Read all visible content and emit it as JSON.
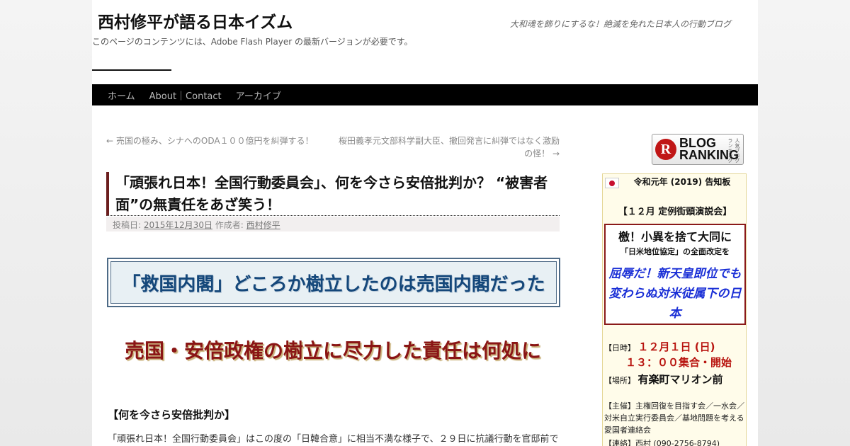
{
  "header": {
    "site_title": "西村修平が語る日本イズム",
    "tagline": "大和魂を飾りにするな！絶滅を免れた日本人の行動ブログ",
    "flash_note": "このページのコンテンツには、Adobe Flash Player の最新バージョンが必要です。"
  },
  "nav": {
    "items": [
      "ホーム",
      "About｜Contact",
      "アーカイブ"
    ]
  },
  "post_nav": {
    "prev": "← 売国の極み、シナへのODA１００億円を糾弾する！",
    "next": "桜田義孝元文部科学副大臣、撤回発言に糾弾ではなく激励の怪！ →"
  },
  "post": {
    "title": "「頑張れ日本！全国行動委員会」、何を今さら安倍批判か？ “被害者面”の無責任をあざ笑う！",
    "meta_posted_label": "投稿日:",
    "meta_date": "2015年12月30日",
    "meta_author_label": "作成者:",
    "meta_author": "西村修平",
    "banner1": "「救国内閣」どころか樹立したのは売国内閣だった",
    "banner2": "売国・安倍政権の樹立に尽力した責任は何処に",
    "section_heading": "【何を今さら安倍批判か】",
    "body_first_line": "「頑張れ日本！全国行動委員会」はこの度の「日韓合意」に相当不満な様子で、２９日に抗議行動を官邸前で"
  },
  "sidebar": {
    "ranking_badge": {
      "logo_letter": "R",
      "text_line1": "BLOG",
      "text_line2": "RANKING",
      "vertical_text": "人気ブログランキング"
    },
    "notice": {
      "heading": "令和元年 (2019) 告知板",
      "event_title": "【１２月 定例街頭演説会】",
      "slogan1": "檄！小異を捨て大同に",
      "slogan2": "「日米地位協定」の全面改定を",
      "slogan3": "屈辱だ！新天皇即位でも変わらぬ対米従属下の日本",
      "date_label": "【日時】",
      "date_value": "１２月１日 (日)",
      "time_value": "１３：００集合・開始",
      "place_label": "【場所】",
      "place_value": "有楽町マリオン前",
      "sponsor": "【主催】主権回復を目指す会／一水会／対米自立実行委員会／基地問題を考える愛国者連絡会",
      "contact": "【連絡】西村 (090-2756-8794)"
    }
  },
  "colors": {
    "nav_bg": "#000000",
    "title_border": "#6b1e1e",
    "banner1_text": "#14477a",
    "banner2_text": "#8a1515",
    "sidebar_bg": "#fffcea",
    "slogan_blue": "#1a2fd6",
    "date_red": "#b8140f"
  }
}
